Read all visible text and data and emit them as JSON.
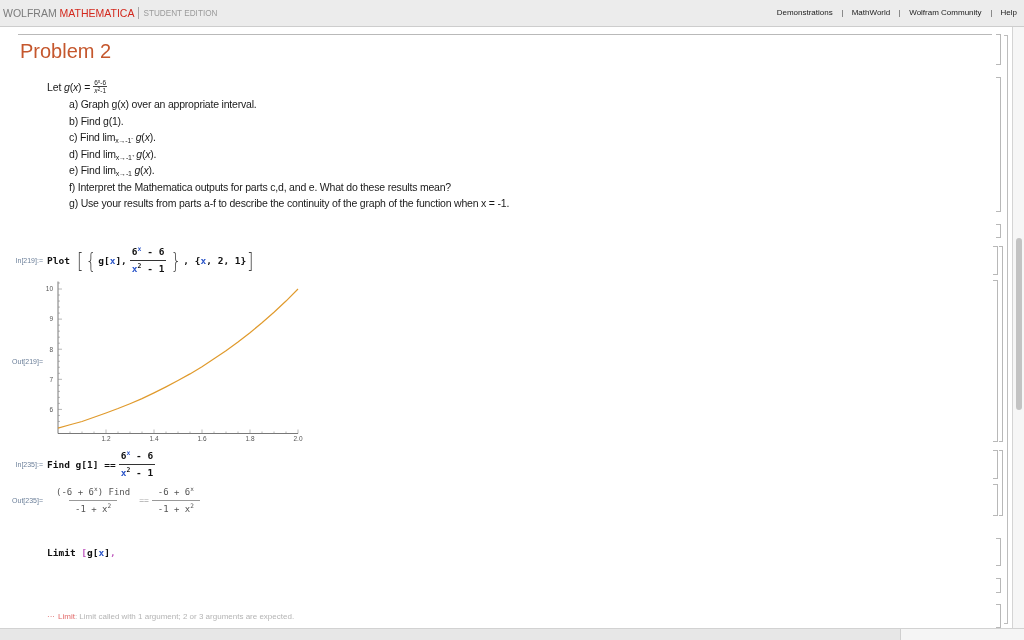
{
  "header": {
    "brand": {
      "maker": "WOLFRAM",
      "product": "MATHEMATICA"
    },
    "edition": "STUDENT EDITION",
    "links": [
      "Demonstrations",
      "MathWorld",
      "Wolfram Community",
      "Help"
    ]
  },
  "notebook": {
    "title": "Problem 2",
    "definition": {
      "lead": "Let *g*(*x*) =",
      "numerator": "6$^{x}$-6",
      "denominator": "*x*$^{2}$-1"
    },
    "tasks": [
      "a) Graph g(x) over an appropriate interval.",
      "b) Find g(1).",
      "c) Find lim$_{x→-1⁻}$ *g*(*x*).",
      "d) Find lim$_{x→-1⁺}$ *g*(*x*).",
      "e) Find lim$_{x→-1}$ *g*(*x*).",
      "f) Interpret the Mathematica outputs for parts c,d, and e. What do these results mean?",
      "g) Use your results from parts a-f to describe the continuity of the graph of the function when x = -1."
    ],
    "cells": [
      {
        "kind": "empty"
      },
      {
        "kind": "group",
        "children": [
          {
            "kind": "input",
            "label": "In[219]:=",
            "segments": [
              {
                "kind": "code",
                "tokens": [
                  {
                    "text": "Plot ",
                    "kind": "plain"
                  },
                  {
                    "text": "[",
                    "kind": "tall"
                  },
                  {
                    "text": "{",
                    "kind": "tall"
                  },
                  {
                    "text": "g[",
                    "kind": "plain"
                  },
                  {
                    "text": "x",
                    "kind": "var"
                  },
                  {
                    "text": "],",
                    "kind": "plain"
                  }
                ]
              },
              {
                "kind": "fraction",
                "numerator": [
                  {
                    "text": "6",
                    "kind": "plain"
                  },
                  {
                    "text": "x",
                    "kind": "varsup"
                  },
                  {
                    "text": " - 6",
                    "kind": "plain"
                  }
                ],
                "denominator": [
                  {
                    "text": "x",
                    "kind": "var"
                  },
                  {
                    "text": "2",
                    "kind": "sup"
                  },
                  {
                    "text": " - 1",
                    "kind": "plain"
                  }
                ]
              },
              {
                "kind": "code",
                "tokens": [
                  {
                    "text": "}",
                    "kind": "tall"
                  },
                  {
                    "text": ", {",
                    "kind": "plain"
                  },
                  {
                    "text": "x",
                    "kind": "var"
                  },
                  {
                    "text": ", 2, 1}",
                    "kind": "plain"
                  },
                  {
                    "text": "]",
                    "kind": "tall"
                  }
                ]
              }
            ]
          },
          {
            "kind": "plot",
            "label": "Out[219]=",
            "chart_data": {
              "type": "line",
              "x": [
                1,
                1.05,
                1.1,
                1.15,
                1.2,
                1.25,
                1.3,
                1.35,
                1.4,
                1.45,
                1.5,
                1.55,
                1.6,
                1.65,
                1.7,
                1.75,
                1.8,
                1.85,
                1.9,
                1.95,
                2
              ],
              "series": [
                {
                  "color": "#e09a2c",
                  "values": [
                    5.38,
                    5.49,
                    5.6,
                    5.74,
                    5.88,
                    6.03,
                    6.19,
                    6.36,
                    6.55,
                    6.75,
                    6.96,
                    7.18,
                    7.42,
                    7.68,
                    7.95,
                    8.24,
                    8.55,
                    8.88,
                    9.23,
                    9.6,
                    10
                  ]
                }
              ],
              "xlim": [
                1,
                2
              ],
              "ylim": [
                5.2,
                10.25
              ],
              "xticks": [
                1.2,
                1.4,
                1.6,
                1.8,
                {
                  "value": 2,
                  "label": "2.0"
                }
              ],
              "yticks": [
                6,
                7,
                8,
                9,
                10
              ]
            }
          }
        ]
      },
      {
        "kind": "group",
        "children": [
          {
            "kind": "input",
            "label": "In[235]:=",
            "segments": [
              {
                "kind": "code",
                "tokens": [
                  {
                    "text": "Find g[1] ==",
                    "kind": "plain"
                  }
                ]
              },
              {
                "kind": "fraction",
                "numerator": [
                  {
                    "text": "6",
                    "kind": "plain"
                  },
                  {
                    "text": "x",
                    "kind": "varsup"
                  },
                  {
                    "text": " - 6",
                    "kind": "plain"
                  }
                ],
                "denominator": [
                  {
                    "text": "x",
                    "kind": "var"
                  },
                  {
                    "text": "2",
                    "kind": "sup"
                  },
                  {
                    "text": " - 1",
                    "kind": "plain"
                  }
                ]
              }
            ]
          },
          {
            "kind": "output",
            "label": "Out[235]=",
            "segments": [
              {
                "kind": "fraction",
                "numerator": [
                  {
                    "text": "(-6 + 6",
                    "kind": "plain"
                  },
                  {
                    "text": "x",
                    "kind": "sup"
                  },
                  {
                    "text": ") Find",
                    "kind": "plain"
                  }
                ],
                "denominator": [
                  {
                    "text": "-1 + x",
                    "kind": "plain"
                  },
                  {
                    "text": "2",
                    "kind": "sup"
                  }
                ]
              },
              {
                "kind": "code",
                "tokens": [
                  {
                    "text": "==",
                    "kind": "op"
                  }
                ]
              },
              {
                "kind": "fraction",
                "numerator": [
                  {
                    "text": "-6 + 6",
                    "kind": "plain"
                  },
                  {
                    "text": "x",
                    "kind": "sup"
                  }
                ],
                "denominator": [
                  {
                    "text": "-1 + x",
                    "kind": "plain"
                  },
                  {
                    "text": "2",
                    "kind": "sup"
                  }
                ]
              }
            ]
          }
        ]
      },
      {
        "kind": "input",
        "segments": [
          {
            "kind": "code",
            "tokens": [
              {
                "text": "Limit ",
                "kind": "plain"
              },
              {
                "text": "[",
                "kind": "error"
              },
              {
                "text": "g[",
                "kind": "plain"
              },
              {
                "text": "x",
                "kind": "var"
              },
              {
                "text": "]",
                "kind": "plain"
              },
              {
                "text": ",",
                "kind": "error"
              }
            ]
          }
        ]
      },
      {
        "kind": "empty"
      },
      {
        "kind": "message",
        "marker": "···",
        "source": "Limit",
        "text": ": Limit called with 1 argument; 2 or 3 arguments are expected."
      }
    ]
  }
}
